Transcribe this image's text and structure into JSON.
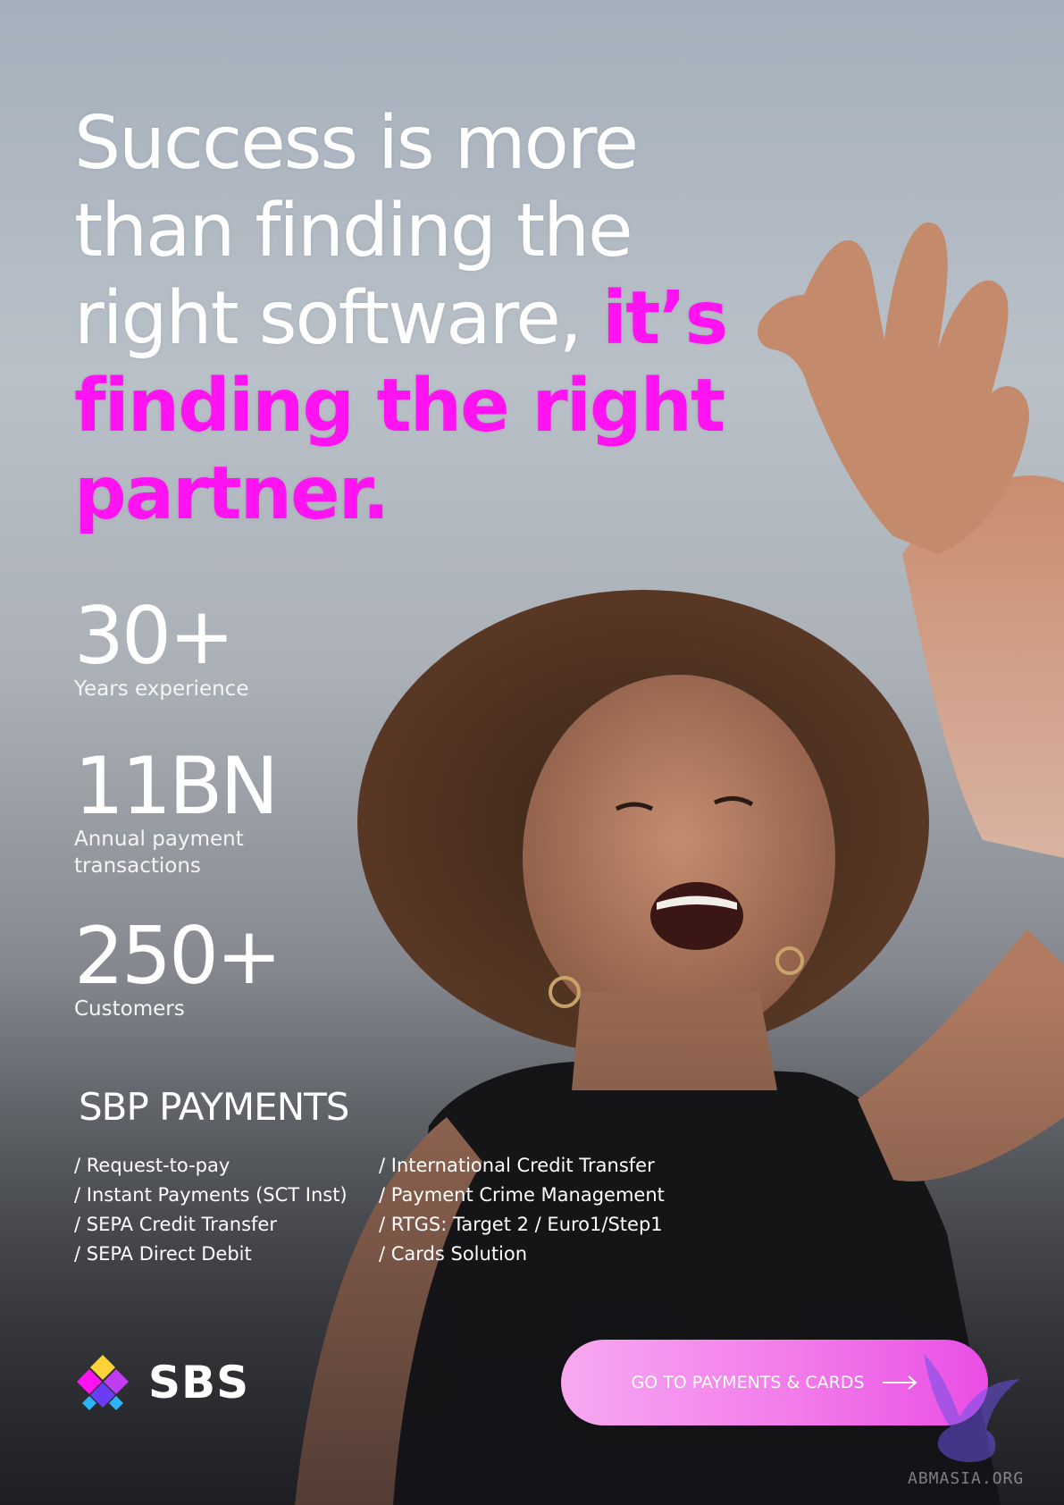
{
  "headline": {
    "line1": "Success is more",
    "line2": "than finding the",
    "line3": "right software, ",
    "accent_line3": "it’s",
    "accent_line4": "finding the right",
    "accent_line5": "partner."
  },
  "stats": [
    {
      "value": "30+",
      "label": "Years experience"
    },
    {
      "value": "11BN",
      "label_line1": "Annual payment",
      "label_line2": "transactions"
    },
    {
      "value": "250+",
      "label": "Customers"
    }
  ],
  "section": {
    "title": "SBP PAYMENTS",
    "col1": [
      "/ Request-to-pay",
      "/ Instant Payments (SCT Inst)",
      "/ SEPA Credit Transfer",
      "/ SEPA Direct Debit"
    ],
    "col2": [
      "/ International Credit Transfer",
      "/ Payment Crime Management",
      "/ RTGS: Target 2 / Euro1/Step1",
      "/ Cards Solution"
    ]
  },
  "logo": {
    "text": "SBS",
    "icon": "sbs-diamond-logo-icon"
  },
  "cta": {
    "label": "GO TO PAYMENTS & CARDS",
    "icon": "arrow-right-icon"
  },
  "watermark": {
    "text": "ABMASIA.ORG",
    "icon": "griffin-watermark-icon"
  },
  "colors": {
    "accent": "#ff13f0",
    "cta_start": "#f7a9f1",
    "cta_end": "#e94ee4",
    "text": "#ffffff"
  }
}
